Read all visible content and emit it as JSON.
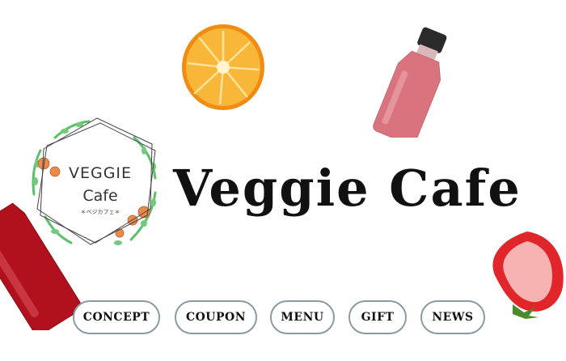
{
  "hero": {
    "title": "Veggie Cafe"
  },
  "logo": {
    "line1": "VEGGIE",
    "line2": "Cafe",
    "subtitle": "＊ベジカフェ＊"
  },
  "nav": {
    "items": [
      {
        "label": "CONCEPT"
      },
      {
        "label": "COUPON"
      },
      {
        "label": "MENU"
      },
      {
        "label": "GIFT"
      },
      {
        "label": "NEWS"
      }
    ]
  },
  "decor": {
    "orange": "#f7a21b",
    "pink_juice": "#d9737d",
    "red_juice": "#b3121f",
    "strawberry": "#e0262a",
    "leaf_green": "#5cc06b",
    "flower_orange": "#e98a4c"
  }
}
